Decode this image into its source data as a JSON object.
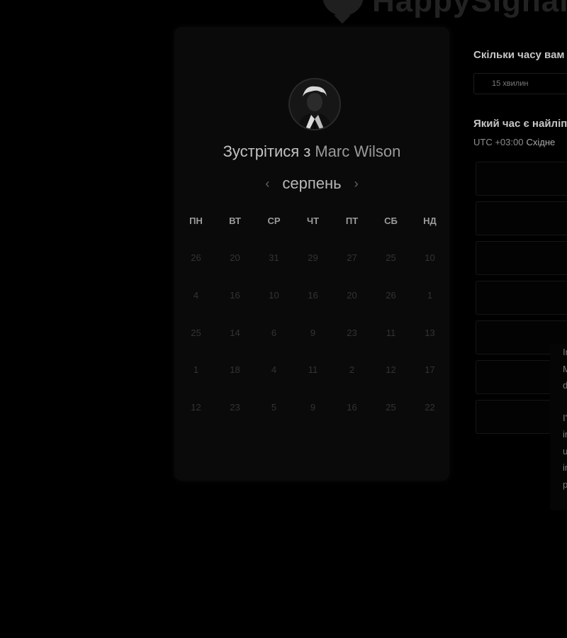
{
  "logo": {
    "text": "HappySignal"
  },
  "booking": {
    "title_prefix": "Зустрітися з",
    "name": "Marc Wilson",
    "month": "серпень",
    "prev_label": "‹",
    "next_label": "›",
    "weekdays": [
      "ПН",
      "ВТ",
      "СР",
      "ЧТ",
      "ПТ",
      "СБ",
      "НД"
    ],
    "days": [
      [
        "26",
        "20",
        "31",
        "29",
        "27",
        "25",
        "10"
      ],
      [
        "4",
        "16",
        "10",
        "16",
        "20",
        "26",
        "1"
      ],
      [
        "25",
        "14",
        "6",
        "9",
        "23",
        "11",
        "13"
      ],
      [
        "1",
        "18",
        "4",
        "11",
        "2",
        "12",
        "17"
      ],
      [
        "12",
        "23",
        "5",
        "9",
        "16",
        "25",
        "22"
      ]
    ]
  },
  "scheduler": {
    "duration_heading": "Скільки часу вам",
    "duration_value": "15 хвилин",
    "time_heading": "Який час є найліп",
    "timezone_offset": "UTC +03:00",
    "timezone_name": "Східне"
  },
  "chat": {
    "lines": [
      "In",
      "M",
      "d",
      "",
      "I'",
      "ir",
      "u",
      "ir",
      "p"
    ]
  }
}
